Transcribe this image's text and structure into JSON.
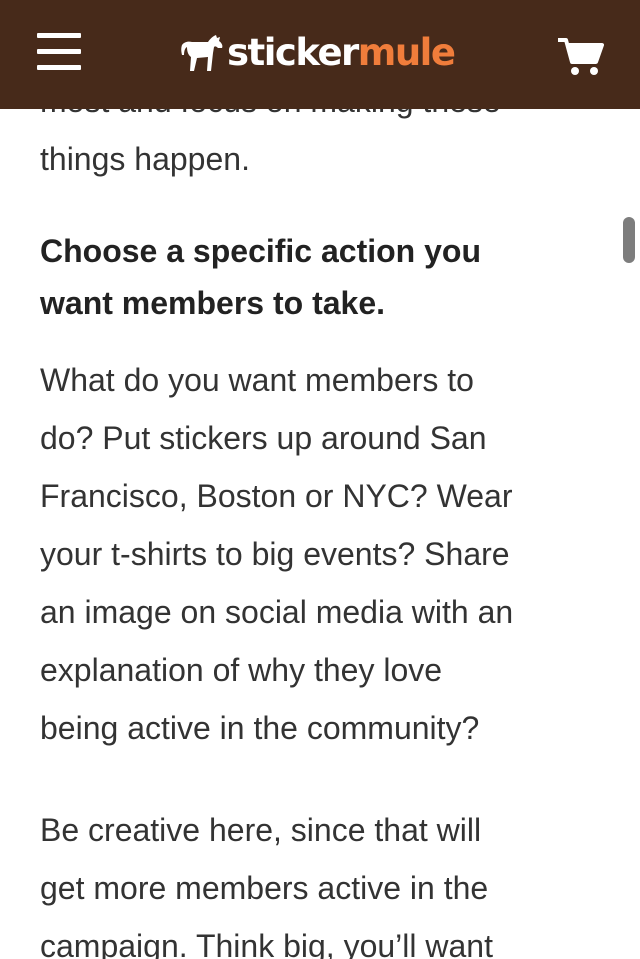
{
  "header": {
    "logo_sticker": "sticker",
    "logo_mule": "mule",
    "brand_color": "#472a1a",
    "accent_color": "#f07d3b",
    "menu_icon": "hamburger-menu-icon",
    "cart_icon": "shopping-cart-icon"
  },
  "article": {
    "partial_line": "most and focus on making these",
    "intro_end": "things happen.",
    "heading_lines": [
      "Choose a specific action you",
      "want members to take."
    ],
    "body_lines": [
      "What do you want members to",
      "do? Put stickers up around San",
      "Francisco, Boston or NYC? Wear",
      "your t-shirts to big events? Share",
      "an image on social media with an",
      "explanation of why they love",
      "being active in the community?"
    ],
    "creative_lines": [
      "Be creative here, since that will",
      "get more members active in the",
      "campaign. Think big, you’ll want"
    ]
  }
}
